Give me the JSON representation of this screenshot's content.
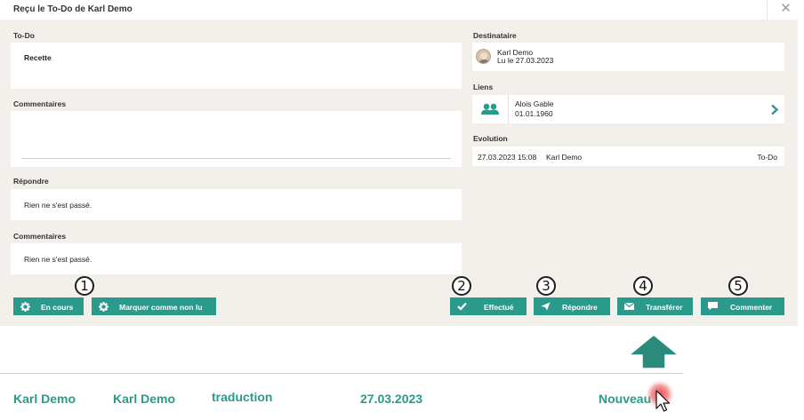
{
  "dialog": {
    "title": "Reçu le To-Do de Karl Demo",
    "close_glyph": "✕"
  },
  "todo": {
    "label": "To-Do",
    "value": "Recette"
  },
  "comments1": {
    "label": "Commentaires",
    "value": ""
  },
  "reply": {
    "label": "Répondre",
    "value": "Rien ne s'est passé."
  },
  "comments2": {
    "label": "Commentaires",
    "value": "Rien ne s'est passé."
  },
  "recipient": {
    "label": "Destinataire",
    "name": "Karl Demo",
    "read_on": "Lu le 27.03.2023",
    "icon": "avatar-photo"
  },
  "links": {
    "label": "Liens",
    "name": "Alois Gable",
    "date": "01.01.1960",
    "icon": "people-icon",
    "chevron_icon": "chevron-right-icon"
  },
  "evolution": {
    "label": "Evolution",
    "entries": [
      {
        "datetime": "27.03.2023 15:08",
        "user": "Karl Demo",
        "status": "To-Do"
      }
    ]
  },
  "buttons": {
    "in_progress": "En cours",
    "mark_unread": "Marquer comme non lu",
    "done": "Effectué",
    "reply": "Répondre",
    "transfer": "Transférer",
    "comment": "Commenter"
  },
  "callouts": [
    "1",
    "2",
    "3",
    "4",
    "5"
  ],
  "lower_row": {
    "col1": "Karl Demo",
    "col2": "Karl Demo",
    "col3": "traduction",
    "col4": "27.03.2023",
    "col5": "Nouveau"
  },
  "colors": {
    "accent": "#2a9a8c",
    "panel_bg": "#f3f0ec",
    "arrow": "#2a8a7c",
    "cursor_highlight": "#e83a3a"
  }
}
